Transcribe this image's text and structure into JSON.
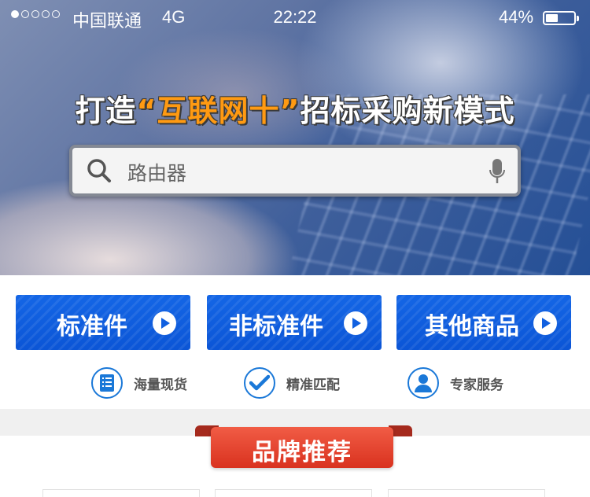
{
  "status_bar": {
    "signal_dots": 5,
    "signal_filled": 1,
    "carrier": "中国联通",
    "network": "4G",
    "time": "22:22",
    "battery_percent_label": "44%",
    "battery_level": 0.44
  },
  "hero": {
    "slogan_before": "打造",
    "slogan_highlight": "“互联网十”",
    "slogan_after": "招标采购新模式",
    "highlight_color": "#ff9a12"
  },
  "search": {
    "placeholder": "路由器",
    "search_icon": "search-icon",
    "mic_icon": "microphone-icon"
  },
  "categories": [
    {
      "label": "标准件",
      "icon": "play-circle-icon"
    },
    {
      "label": "非标准件",
      "icon": "play-circle-icon"
    },
    {
      "label": "其他商品",
      "icon": "play-circle-icon"
    }
  ],
  "features": [
    {
      "label": "海量现货",
      "icon": "document-list-icon"
    },
    {
      "label": "精准匹配",
      "icon": "checkmark-icon"
    },
    {
      "label": "专家服务",
      "icon": "user-icon"
    }
  ],
  "section": {
    "title": "品牌推荐"
  },
  "colors": {
    "button_blue": "#0b55d6",
    "ribbon_red": "#d9321f",
    "icon_blue": "#1a78d8"
  }
}
